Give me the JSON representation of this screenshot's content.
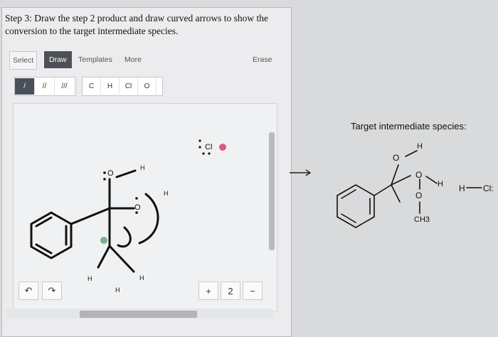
{
  "prompt": {
    "line1": "Step 3: Draw the step 2 product and draw curved arrows to show the",
    "line2": "conversion to the target intermediate species."
  },
  "toolbar": {
    "select": "Select",
    "draw": "Draw",
    "templates": "Templates",
    "more": "More",
    "erase": "Erase"
  },
  "tools": {
    "single_bond": "/",
    "double_bond": "//",
    "triple_bond": "///",
    "carbon": "C",
    "hydrogen": "H",
    "chlorine": "Cl",
    "oxygen": "O"
  },
  "canvas": {
    "o_top": "O",
    "h_top": "H",
    "o_mid": "O",
    "h_right": "H",
    "h_left_bottom": "H",
    "h_bottom": "H",
    "h_bottom_right": "H",
    "cl": "Cl"
  },
  "controls": {
    "undo": "↶",
    "redo": "↷",
    "zoom_in": "+",
    "reset": "2",
    "zoom_out": "−"
  },
  "target": {
    "title": "Target intermediate species:",
    "h_top": "H",
    "o_left": "O",
    "o_ring": "O",
    "h_ring": "H",
    "o_bottom": "O",
    "ch3": "CH3",
    "hcl_h": "H",
    "hcl_cl": "Cl:"
  },
  "colors": {
    "draw_tab": "#4d5057",
    "panel": "#ececee",
    "background": "#d9dadc",
    "charge_marker": "#e05a7a",
    "selection_dot": "#7ab08a"
  },
  "icons": {
    "undo": "undo-icon",
    "redo": "redo-icon",
    "zoom_in": "zoom-in-icon",
    "reset": "reset-icon",
    "zoom_out": "zoom-out-icon",
    "arrow": "reaction-arrow-icon"
  }
}
